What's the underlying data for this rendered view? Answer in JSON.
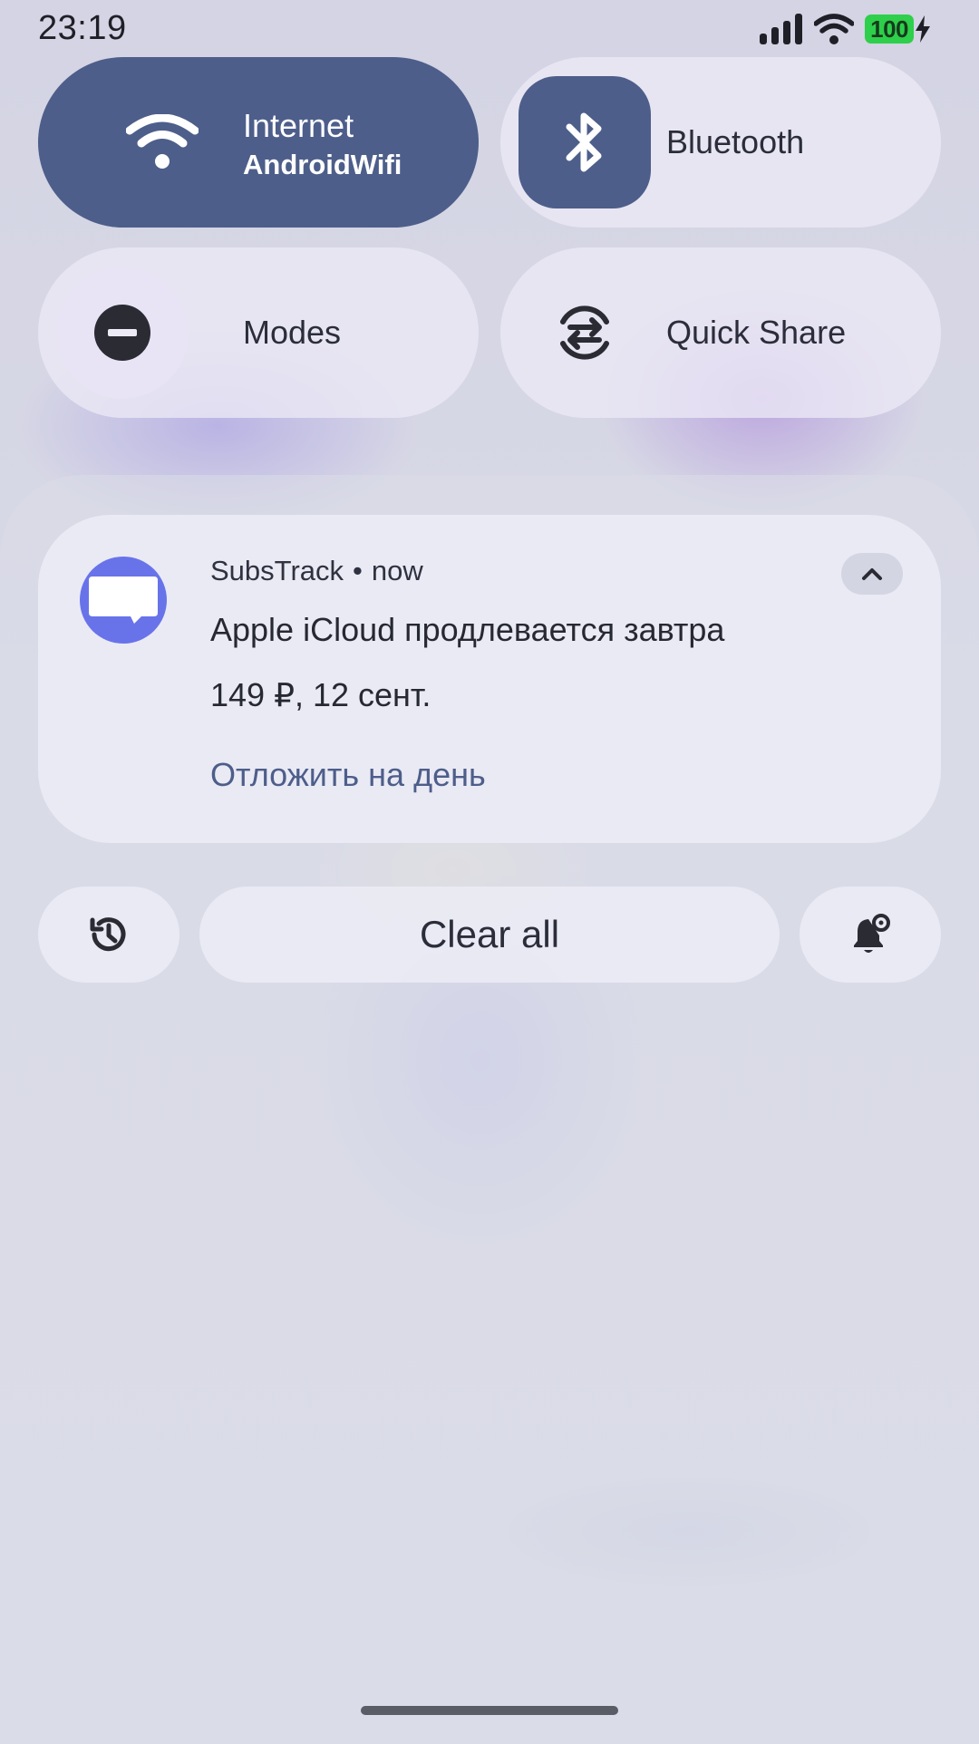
{
  "status_bar": {
    "time": "23:19",
    "battery_level": "100",
    "icons": [
      "signal-icon",
      "wifi-icon",
      "battery-icon",
      "charging-bolt-icon"
    ]
  },
  "quick_settings": {
    "internet": {
      "label": "Internet",
      "sublabel": "AndroidWifi",
      "icon": "wifi-icon",
      "active": true
    },
    "bluetooth": {
      "label": "Bluetooth",
      "icon": "bluetooth-icon",
      "active": true
    },
    "modes": {
      "label": "Modes",
      "icon": "do-not-disturb-icon",
      "active": false
    },
    "quick_share": {
      "label": "Quick Share",
      "icon": "quick-share-icon",
      "active": false
    }
  },
  "notification": {
    "app_name": "SubsTrack",
    "separator": "•",
    "time": "now",
    "title": "Apple iCloud продлевается завтра",
    "text": "149 ₽, 12 сент.",
    "action": "Отложить на день",
    "app_icon": "message-icon"
  },
  "actions": {
    "history_icon": "history-icon",
    "clear_all": "Clear all",
    "settings_icon": "notification-settings-icon"
  },
  "colors": {
    "accent": "#4d5e8a",
    "app_icon_bg": "#6873ea",
    "battery": "#2ecf4a"
  }
}
